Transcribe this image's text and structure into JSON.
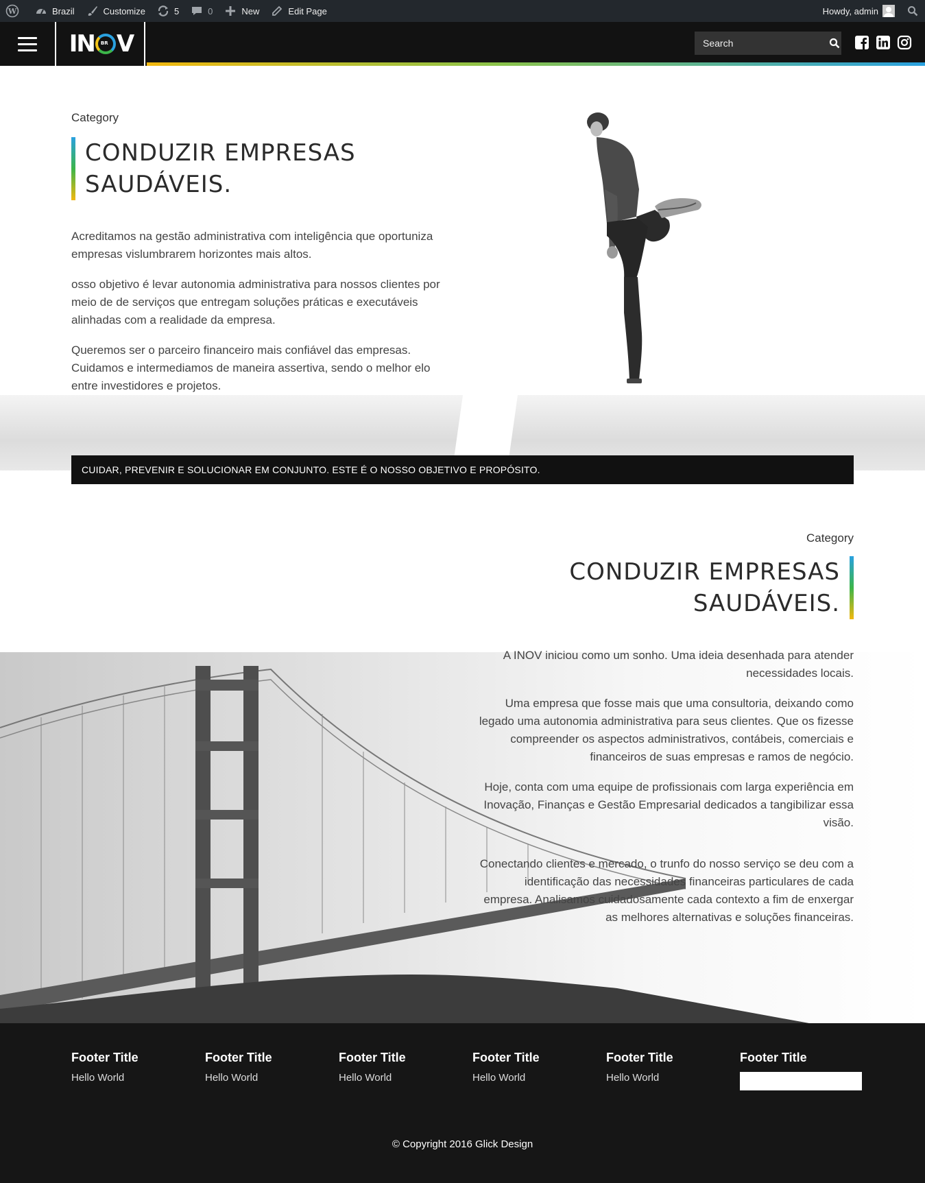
{
  "adminbar": {
    "site_name": "Brazil",
    "customize": "Customize",
    "updates_count": "5",
    "comments_count": "0",
    "new_label": "New",
    "edit_page": "Edit Page",
    "howdy": "Howdy, admin"
  },
  "header": {
    "logo_left": "IN",
    "logo_small": "BR",
    "logo_right": "V",
    "search_placeholder": "Search"
  },
  "section1": {
    "category": "Category",
    "title_line1": "CONDUZIR EMPRESAS",
    "title_line2": "SAUDÁVEIS.",
    "paragraphs": [
      "Acreditamos na gestão administrativa com inteligência que oportuniza empresas vislumbrarem horizontes mais altos.",
      "osso objetivo é levar autonomia administrativa para nossos clientes por meio de de serviços que entregam soluções práticas e executáveis alinhadas com a realidade da empresa.",
      "Queremos ser o parceiro financeiro mais confiável das empresas. Cuidamos e intermediamos de maneira assertiva, sendo o melhor elo entre investidores e projetos."
    ]
  },
  "banner": "CUIDAR, PREVENIR E SOLUCIONAR EM CONJUNTO. ESTE É O NOSSO OBJETIVO E PROPÓSITO.",
  "section2": {
    "category": "Category",
    "title_line1": "CONDUZIR EMPRESAS",
    "title_line2": "SAUDÁVEIS.",
    "paragraphs": [
      "A INOV iniciou como um sonho. Uma ideia desenhada para atender necessidades locais.",
      "Uma empresa que fosse mais que uma consultoria, deixando como legado uma autonomia administrativa para seus clientes. Que os fizesse compreender os aspectos administrativos, contábeis, comerciais e financeiros de suas empresas e ramos de negócio.",
      "Hoje, conta com uma equipe de profissionais com larga experiência em Inovação, Finanças e Gestão Empresarial dedicados a tangibilizar essa visão.",
      "Conectando clientes e mercado, o trunfo do nosso serviço se deu com a identificação das necessidades financeiras particulares de cada empresa. Analisamos cuidadosamente cada contexto a fim de enxergar as melhores alternativas e soluções financeiras."
    ]
  },
  "footer": {
    "columns": [
      {
        "title": "Footer Title",
        "item": "Hello World"
      },
      {
        "title": "Footer Title",
        "item": "Hello World"
      },
      {
        "title": "Footer Title",
        "item": "Hello World"
      },
      {
        "title": "Footer Title",
        "item": "Hello World"
      },
      {
        "title": "Footer Title",
        "item": "Hello World"
      },
      {
        "title": "Footer Title"
      }
    ],
    "copyright": "© Copyright 2016 Glick Design"
  },
  "colors": {
    "admin_bar": "#23282d",
    "header": "#121212",
    "footer": "#161616",
    "accent_blue": "#2aa1e0",
    "accent_green": "#3cb54a",
    "accent_yellow": "#f2b80f"
  },
  "icons": [
    "wordpress-icon",
    "dashboard-icon",
    "brush-icon",
    "updates-icon",
    "comment-icon",
    "plus-icon",
    "pencil-icon",
    "search-icon",
    "facebook-icon",
    "linkedin-icon",
    "instagram-icon"
  ]
}
